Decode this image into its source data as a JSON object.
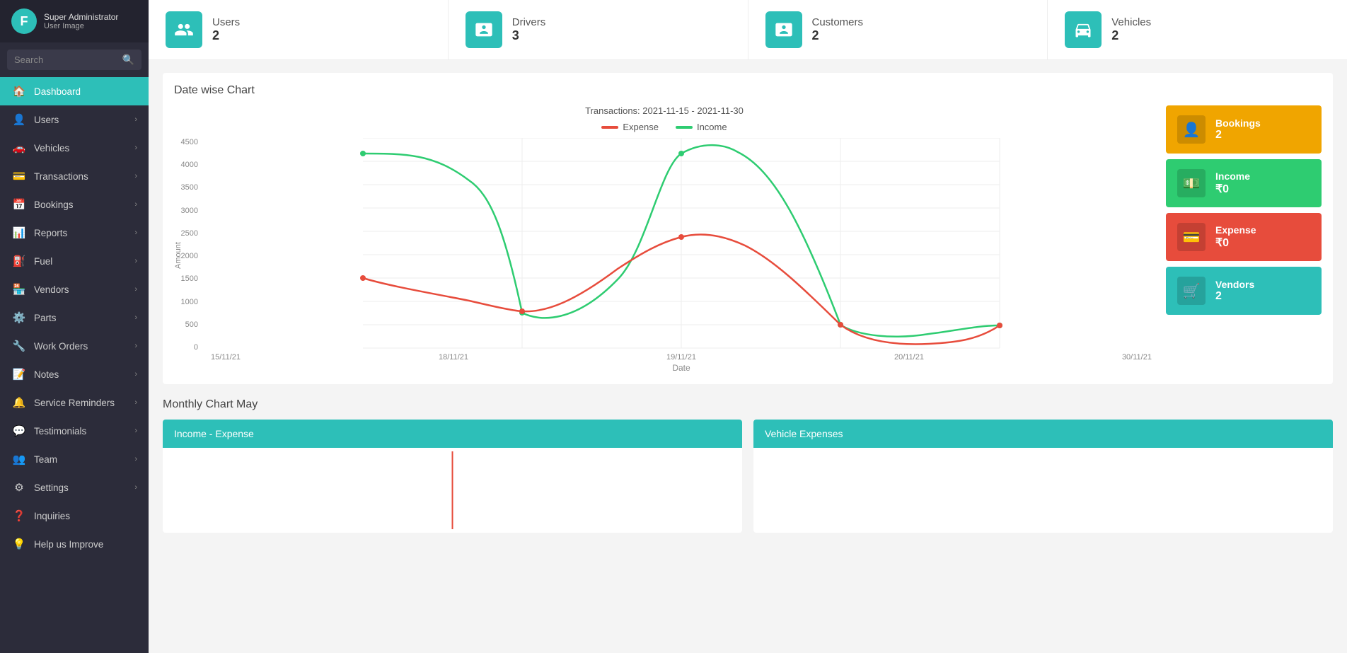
{
  "app": {
    "logo_letter": "F",
    "user_label": "User Image",
    "user_role": "Super Administrator"
  },
  "sidebar": {
    "search_placeholder": "Search",
    "items": [
      {
        "id": "dashboard",
        "label": "Dashboard",
        "icon": "🏠",
        "active": true,
        "has_arrow": false
      },
      {
        "id": "users",
        "label": "Users",
        "icon": "👤",
        "active": false,
        "has_arrow": true
      },
      {
        "id": "vehicles",
        "label": "Vehicles",
        "icon": "🚗",
        "active": false,
        "has_arrow": true
      },
      {
        "id": "transactions",
        "label": "Transactions",
        "icon": "💳",
        "active": false,
        "has_arrow": true
      },
      {
        "id": "bookings",
        "label": "Bookings",
        "icon": "📅",
        "active": false,
        "has_arrow": true
      },
      {
        "id": "reports",
        "label": "Reports",
        "icon": "📊",
        "active": false,
        "has_arrow": true
      },
      {
        "id": "fuel",
        "label": "Fuel",
        "icon": "⛽",
        "active": false,
        "has_arrow": true
      },
      {
        "id": "vendors",
        "label": "Vendors",
        "icon": "🏪",
        "active": false,
        "has_arrow": true
      },
      {
        "id": "parts",
        "label": "Parts",
        "icon": "⚙️",
        "active": false,
        "has_arrow": true
      },
      {
        "id": "workorders",
        "label": "Work Orders",
        "icon": "🔧",
        "active": false,
        "has_arrow": true
      },
      {
        "id": "notes",
        "label": "Notes",
        "icon": "📝",
        "active": false,
        "has_arrow": true
      },
      {
        "id": "servicereminders",
        "label": "Service Reminders",
        "icon": "🔔",
        "active": false,
        "has_arrow": true
      },
      {
        "id": "testimonials",
        "label": "Testimonials",
        "icon": "💬",
        "active": false,
        "has_arrow": true
      },
      {
        "id": "team",
        "label": "Team",
        "icon": "👥",
        "active": false,
        "has_arrow": true
      },
      {
        "id": "settings",
        "label": "Settings",
        "icon": "⚙",
        "active": false,
        "has_arrow": true
      },
      {
        "id": "inquiries",
        "label": "Inquiries",
        "icon": "❓",
        "active": false,
        "has_arrow": false
      },
      {
        "id": "helpusimprove",
        "label": "Help us Improve",
        "icon": "💡",
        "active": false,
        "has_arrow": false
      }
    ]
  },
  "stat_cards": [
    {
      "id": "users",
      "label": "Users",
      "value": "2",
      "icon": "users"
    },
    {
      "id": "drivers",
      "label": "Drivers",
      "value": "3",
      "icon": "drivers"
    },
    {
      "id": "customers",
      "label": "Customers",
      "value": "2",
      "icon": "customers"
    },
    {
      "id": "vehicles",
      "label": "Vehicles",
      "value": "2",
      "icon": "vehicles"
    }
  ],
  "date_chart": {
    "title": "Date wise Chart",
    "subtitle": "Transactions: 2021-11-15 - 2021-11-30",
    "legend_expense": "Expense",
    "legend_income": "Income",
    "x_axis_label": "Date",
    "y_axis_label": "Amount",
    "x_labels": [
      "15/11/21",
      "18/11/21",
      "19/11/21",
      "20/11/21",
      "30/11/21"
    ],
    "y_labels": [
      "4500",
      "4000",
      "3500",
      "3000",
      "2500",
      "2000",
      "1500",
      "1000",
      "500",
      "0"
    ]
  },
  "side_cards": [
    {
      "id": "bookings",
      "label": "Bookings",
      "value": "2",
      "type": "bookings"
    },
    {
      "id": "income",
      "label": "Income",
      "value": "₹0",
      "type": "income"
    },
    {
      "id": "expense",
      "label": "Expense",
      "value": "₹0",
      "type": "expense"
    },
    {
      "id": "vendors",
      "label": "Vendors",
      "value": "2",
      "type": "vendors"
    }
  ],
  "monthly": {
    "title": "Monthly Chart May",
    "income_expense_label": "Income - Expense",
    "vehicle_expenses_label": "Vehicle Expenses"
  }
}
